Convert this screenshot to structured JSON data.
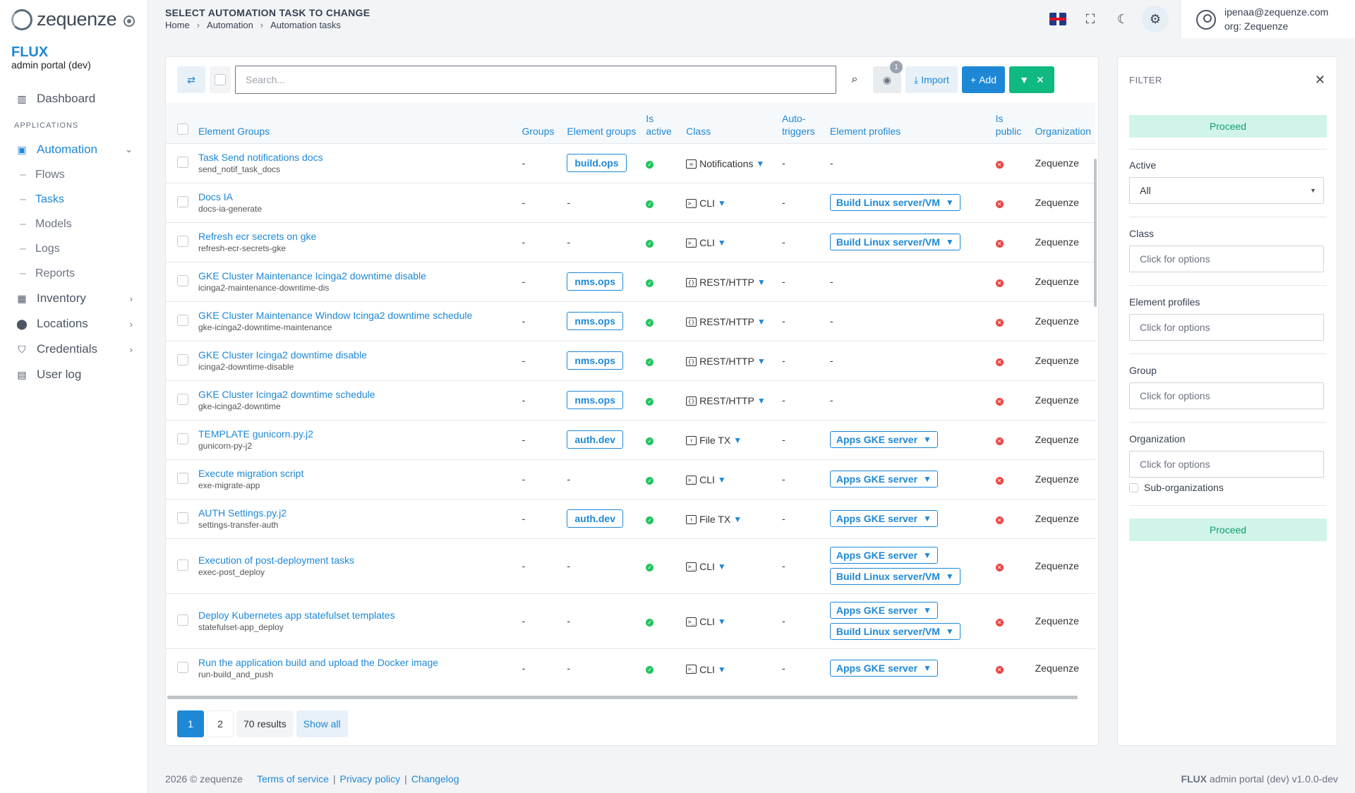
{
  "app": {
    "logo_text": "zequenze",
    "brand_title": "FLUX",
    "brand_subtitle": "admin portal (dev)"
  },
  "sidebar": {
    "dashboard": "Dashboard",
    "section_applications": "APPLICATIONS",
    "automation": "Automation",
    "automation_children": [
      "Flows",
      "Tasks",
      "Models",
      "Logs",
      "Reports"
    ],
    "inventory": "Inventory",
    "locations": "Locations",
    "credentials": "Credentials",
    "user_log": "User log"
  },
  "header": {
    "title": "SELECT AUTOMATION TASK TO CHANGE",
    "breadcrumb": [
      "Home",
      "Automation",
      "Automation tasks"
    ],
    "user_email": "ipenaa@zequenze.com",
    "user_org": "org: Zequenze"
  },
  "toolbar": {
    "search_placeholder": "Search...",
    "eye_badge": "1",
    "import_label": "Import",
    "add_label": "Add"
  },
  "table": {
    "columns": [
      "Element Groups",
      "Groups",
      "Element groups",
      "Is active",
      "Class",
      "Auto-triggers",
      "Element profiles",
      "Is public",
      "Organization"
    ],
    "rows": [
      {
        "title": "Task Send notifications docs",
        "slug": "send_notif_task_docs",
        "groups": "-",
        "element_group": "build.ops",
        "class": "Notifications",
        "class_icon": "envelope-icon",
        "auto": "-",
        "profiles": [],
        "org": "Zequenze"
      },
      {
        "title": "Docs IA",
        "slug": "docs-ia-generate",
        "groups": "-",
        "element_group": "-",
        "class": "CLI",
        "class_icon": "terminal-icon",
        "auto": "-",
        "profiles": [
          "Build Linux server/VM"
        ],
        "org": "Zequenze"
      },
      {
        "title": "Refresh ecr secrets on gke",
        "slug": "refresh-ecr-secrets-gke",
        "groups": "-",
        "element_group": "-",
        "class": "CLI",
        "class_icon": "terminal-icon",
        "auto": "-",
        "profiles": [
          "Build Linux server/VM"
        ],
        "org": "Zequenze"
      },
      {
        "title": "GKE Cluster Maintenance Icinga2 downtime disable",
        "slug": "icinga2-maintenance-downtime-dis",
        "groups": "-",
        "element_group": "nms.ops",
        "class": "REST/HTTP",
        "class_icon": "json-file-icon",
        "auto": "-",
        "profiles": [],
        "org": "Zequenze"
      },
      {
        "title": "GKE Cluster Maintenance Window Icinga2 downtime schedule",
        "slug": "gke-icinga2-downtime-maintenance",
        "groups": "-",
        "element_group": "nms.ops",
        "class": "REST/HTTP",
        "class_icon": "json-file-icon",
        "auto": "-",
        "profiles": [],
        "org": "Zequenze"
      },
      {
        "title": "GKE Cluster Icinga2 downtime disable",
        "slug": "icinga2-downtime-disable",
        "groups": "-",
        "element_group": "nms.ops",
        "class": "REST/HTTP",
        "class_icon": "json-file-icon",
        "auto": "-",
        "profiles": [],
        "org": "Zequenze"
      },
      {
        "title": "GKE Cluster Icinga2 downtime schedule",
        "slug": "gke-icinga2-downtime",
        "groups": "-",
        "element_group": "nms.ops",
        "class": "REST/HTTP",
        "class_icon": "json-file-icon",
        "auto": "-",
        "profiles": [],
        "org": "Zequenze"
      },
      {
        "title": "TEMPLATE gunicorn.py.j2",
        "slug": "gunicorn-py-j2",
        "groups": "-",
        "element_group": "auth.dev",
        "class": "File TX",
        "class_icon": "file-upload-icon",
        "auto": "-",
        "profiles": [
          "Apps GKE server"
        ],
        "org": "Zequenze"
      },
      {
        "title": "Execute migration script",
        "slug": "exe-migrate-app",
        "groups": "-",
        "element_group": "-",
        "class": "CLI",
        "class_icon": "terminal-icon",
        "auto": "-",
        "profiles": [
          "Apps GKE server"
        ],
        "org": "Zequenze"
      },
      {
        "title": "AUTH Settings.py.j2",
        "slug": "settings-transfer-auth",
        "groups": "-",
        "element_group": "auth.dev",
        "class": "File TX",
        "class_icon": "file-upload-icon",
        "auto": "-",
        "profiles": [
          "Apps GKE server"
        ],
        "org": "Zequenze"
      },
      {
        "title": "Execution of post-deployment tasks",
        "slug": "exec-post_deploy",
        "groups": "-",
        "element_group": "-",
        "class": "CLI",
        "class_icon": "terminal-icon",
        "auto": "-",
        "profiles": [
          "Apps GKE server",
          "Build Linux server/VM"
        ],
        "org": "Zequenze"
      },
      {
        "title": "Deploy Kubernetes app statefulset templates",
        "slug": "statefulset-app_deploy",
        "groups": "-",
        "element_group": "-",
        "class": "CLI",
        "class_icon": "terminal-icon",
        "auto": "-",
        "profiles": [
          "Apps GKE server",
          "Build Linux server/VM"
        ],
        "org": "Zequenze"
      },
      {
        "title": "Run the application build and upload the Docker image",
        "slug": "run-build_and_push",
        "groups": "-",
        "element_group": "-",
        "class": "CLI",
        "class_icon": "terminal-icon",
        "auto": "-",
        "profiles": [
          "Apps GKE server"
        ],
        "org": "Zequenze"
      }
    ]
  },
  "pagination": {
    "pages": [
      "1",
      "2"
    ],
    "results": "70 results",
    "show_all": "Show all"
  },
  "filter": {
    "title": "FILTER",
    "proceed": "Proceed",
    "active_label": "Active",
    "active_value": "All",
    "class_label": "Class",
    "class_placeholder": "Click for options",
    "profiles_label": "Element profiles",
    "profiles_placeholder": "Click for options",
    "group_label": "Group",
    "group_placeholder": "Click for options",
    "org_label": "Organization",
    "org_placeholder": "Click for options",
    "suborg_label": "Sub-organizations"
  },
  "footer": {
    "copyright": "2026 © zequenze",
    "links": [
      "Terms of service",
      "Privacy policy",
      "Changelog"
    ],
    "brand": "FLUX",
    "version": "admin portal (dev) v1.0.0-dev"
  },
  "colors": {
    "accent": "#1e88d6",
    "success": "#10b981",
    "danger": "#ef4444"
  }
}
